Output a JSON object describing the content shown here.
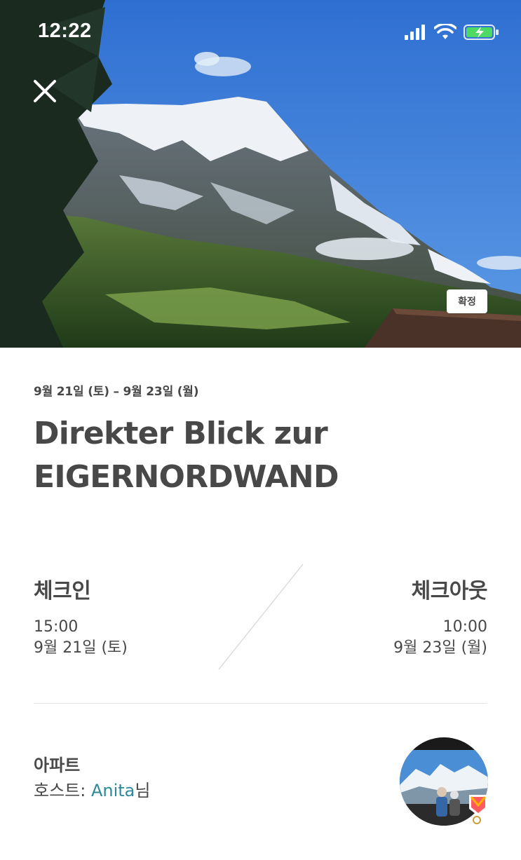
{
  "status_bar": {
    "time": "12:22",
    "icons": [
      "signal-icon",
      "wifi-icon",
      "battery-charging-icon"
    ]
  },
  "header": {
    "close_icon": "close-icon",
    "badge_label": "확정"
  },
  "reservation": {
    "date_range": "9월 21일 (토) – 9월 23일 (월)",
    "title_line1": "Direkter Blick zur",
    "title_line2": "EIGERNORDWAND"
  },
  "checkin": {
    "label": "체크인",
    "time": "15:00",
    "date": "9월 21일 (토)"
  },
  "checkout": {
    "label": "체크아웃",
    "time": "10:00",
    "date": "9월 23일 (월)"
  },
  "host_section": {
    "room_type": "아파트",
    "host_prefix": "호스트: ",
    "host_name": "Anita",
    "host_suffix": "님",
    "superhost_icon": "superhost-badge-icon"
  },
  "colors": {
    "text": "#484848",
    "link": "#2a8a99",
    "divider": "#e4e4e4",
    "sky": "#3b7fd9"
  }
}
